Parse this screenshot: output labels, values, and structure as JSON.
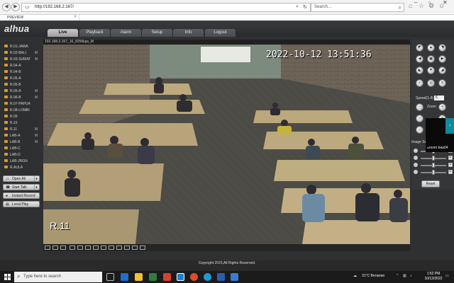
{
  "browser": {
    "url": "http://192.168.2.167/",
    "search_placeholder": "Search...",
    "tab_title": "PREVIEW",
    "back_icon": "back-arrow-icon",
    "forward_icon": "forward-arrow-icon"
  },
  "app": {
    "logo": "alhua",
    "nav": [
      "Live",
      "Playback",
      "Alarm",
      "Setup",
      "Info",
      "Logout"
    ],
    "active_nav": "Live",
    "channels": [
      {
        "label": "R.01-JAWA",
        "flag": ""
      },
      {
        "label": "R.02-BALI",
        "flag": "M"
      },
      {
        "label": "R.03-SUMAT",
        "flag": "M"
      },
      {
        "label": "R.04-A",
        "flag": ""
      },
      {
        "label": "R.04-B",
        "flag": ""
      },
      {
        "label": "R.05-A",
        "flag": ""
      },
      {
        "label": "R.05-B",
        "flag": ""
      },
      {
        "label": "R.06-A",
        "flag": "M"
      },
      {
        "label": "R.06-B",
        "flag": "M"
      },
      {
        "label": "R.07-PAPUA",
        "flag": ""
      },
      {
        "label": "R.08-LOMBI",
        "flag": ""
      },
      {
        "label": "R.09",
        "flag": ""
      },
      {
        "label": "R.10",
        "flag": ""
      },
      {
        "label": "R.11",
        "flag": "M"
      },
      {
        "label": "LAB-A",
        "flag": "M"
      },
      {
        "label": "LAB-B",
        "flag": "M"
      },
      {
        "label": "LAB-C",
        "flag": ""
      },
      {
        "label": "LAB-D",
        "flag": ""
      },
      {
        "label": "LAB-JRGN",
        "flag": ""
      },
      {
        "label": "R.AULA",
        "flag": ""
      }
    ],
    "left_buttons": [
      {
        "label": "Open All",
        "icon": "monitor-icon"
      },
      {
        "label": "Start Talk",
        "icon": "phone-icon"
      },
      {
        "label": "Instant Record",
        "icon": "record-icon"
      },
      {
        "label": "Local Play",
        "icon": "film-icon"
      }
    ],
    "video": {
      "info": "192.168.2.167_16_8256kps_M",
      "timestamp": "2022-10-12 13:51:36",
      "channel_label": "R.11"
    },
    "ptz": {
      "speed_label": "Speed(1-8)",
      "speed_value": "5",
      "zoom_label": "Zoom"
    },
    "image_settings": {
      "label": "Image Se",
      "levels": [
        0.5,
        0.5,
        0.5,
        0.5
      ],
      "reset_label": "Reset"
    },
    "overlay": {
      "zoom_text": "zoom baa04"
    },
    "footer": "Copyright 2015,All Rights Reserved."
  },
  "taskbar": {
    "search_placeholder": "Type here to search",
    "weather": "31°C  Berawan",
    "time": "1:52 PM",
    "date": "10/12/2022"
  }
}
